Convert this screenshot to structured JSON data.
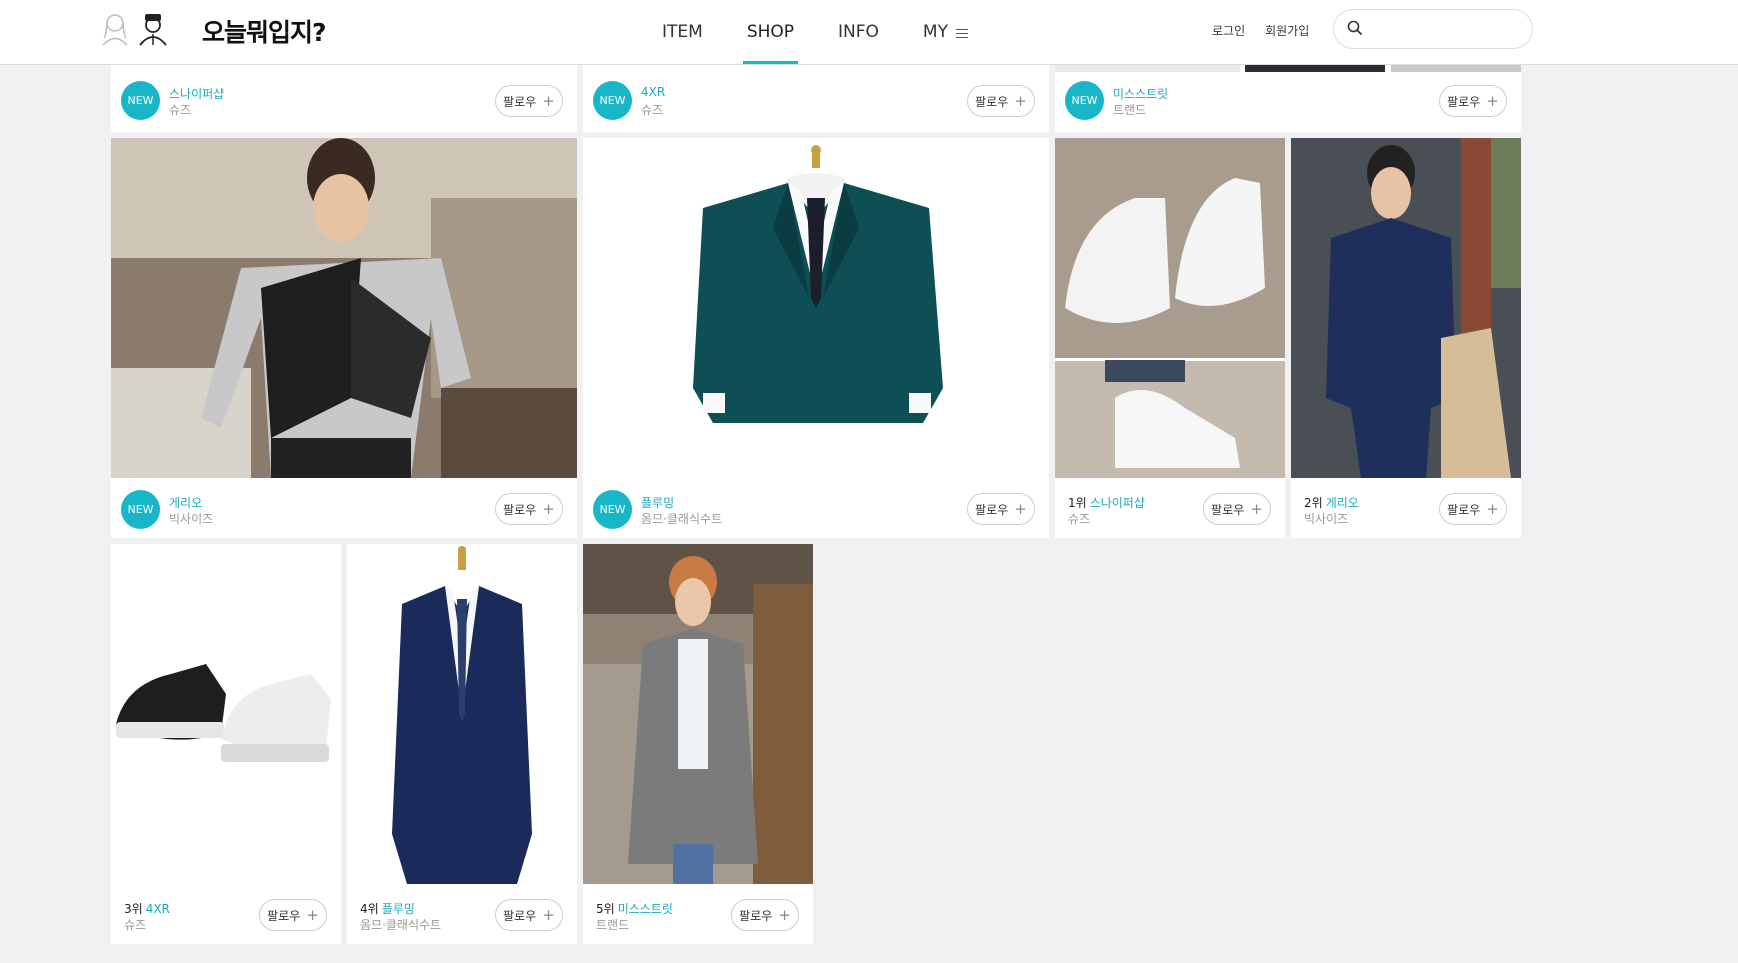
{
  "header": {
    "logo": "오늘뭐입지?",
    "nav": [
      {
        "label": "ITEM"
      },
      {
        "label": "SHOP",
        "active": true
      },
      {
        "label": "INFO"
      },
      {
        "label": "MY"
      }
    ],
    "login": "로그인",
    "signup": "회원가입",
    "search_value": ""
  },
  "follow_label": "팔로우",
  "new_label": "NEW",
  "cards_top": [
    {
      "name": "스나이퍼샵",
      "category": "슈즈"
    },
    {
      "name": "4XR",
      "category": "슈즈"
    },
    {
      "name": "미스스트릿",
      "category": "트랜드"
    }
  ],
  "cards_mid": [
    {
      "name": "게리오",
      "category": "빅사이즈",
      "badge": "NEW"
    },
    {
      "name": "플루밍",
      "category": "옴므·클래식수트",
      "badge": "NEW"
    },
    {
      "rank": "1위",
      "name": "스나이퍼샵",
      "category": "슈즈"
    },
    {
      "rank": "2위",
      "name": "게리오",
      "category": "빅사이즈"
    }
  ],
  "cards_bottom": [
    {
      "rank": "3위",
      "name": "4XR",
      "category": "슈즈"
    },
    {
      "rank": "4위",
      "name": "플루밍",
      "category": "옴므·클래식수트"
    },
    {
      "rank": "5위",
      "name": "미스스트릿",
      "category": "트랜드"
    }
  ],
  "colors": {
    "accent": "#19b5c9",
    "background": "#f1f1f3"
  }
}
